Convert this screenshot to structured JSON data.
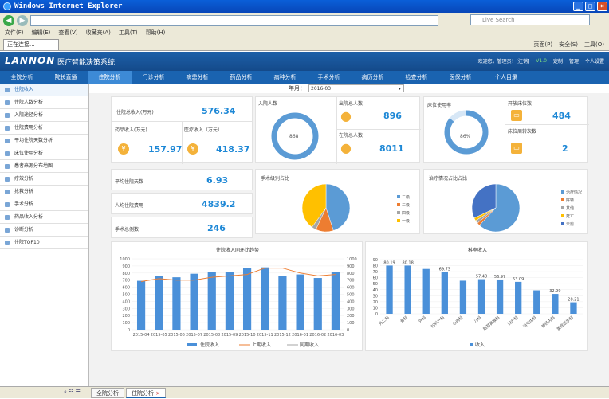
{
  "browser": {
    "title": "Windows Internet Explorer",
    "search_placeholder": "Live Search",
    "menu": [
      "文件(F)",
      "编辑(E)",
      "查看(V)",
      "收藏夹(A)",
      "工具(T)",
      "帮助(H)"
    ],
    "tab_label": "正在连接...",
    "tools": [
      "页面(P)",
      "安全(S)",
      "工具(O)"
    ]
  },
  "app": {
    "logo": "LANNON",
    "title": "医疗智能决策系统",
    "user_text": "欢迎您，管理员！[注销]",
    "version": "V1.0",
    "links": [
      "定制",
      "管理",
      "个人设置"
    ]
  },
  "nav": [
    "全院分析",
    "院长直通",
    "住院分析",
    "门诊分析",
    "病患分析",
    "药品分析",
    "病种分析",
    "手术分析",
    "病历分析",
    "检查分析",
    "医保分析",
    "个人目录"
  ],
  "month": {
    "label": "年月：",
    "value": "2016-03"
  },
  "sidebar": [
    "住院收入",
    "住院人数分析",
    "入院途径分析",
    "住院费用分析",
    "平均住院天数分析",
    "床位使用分析",
    "患者来源分布地图",
    "疗效分析",
    "抢救分析",
    "手术分析",
    "药品收入分析",
    "诊断分析",
    "住院TOP10"
  ],
  "kpi": {
    "inpatient_income_label": "住院总收入(万元)",
    "inpatient_income": "576.34",
    "drug_income_label": "药品收入(万元)",
    "drug_income": "157.97",
    "medical_income_label": "医疗收入（万元）",
    "medical_income": "418.37",
    "admission_label": "入院人数",
    "admission": "868",
    "discharge_label": "出院总人数",
    "discharge": "896",
    "in_hospital_label": "在院总人数",
    "in_hospital": "8011",
    "bed_rate_label": "床位使用率",
    "bed_rate": "86%",
    "open_beds_label": "开放床位数",
    "open_beds": "484",
    "bed_turnover_label": "床位周转次数",
    "bed_turnover": "2",
    "avg_days_label": "平均住院天数",
    "avg_days": "6.93",
    "avg_cost_label": "人均住院费用",
    "avg_cost": "4839.2",
    "surgery_label": "手术总例数",
    "surgery": "246"
  },
  "pie_surgery": {
    "title": "手术级别占比",
    "legend": [
      "二级",
      "三级",
      "四级",
      "一级"
    ],
    "colors": [
      "#5b9bd5",
      "#ed7d31",
      "#a5a5a5",
      "#ffc000"
    ],
    "values": [
      45,
      12,
      3,
      40
    ]
  },
  "pie_outcome": {
    "title": "治疗情况占比占比",
    "legend": [
      "治疗情况",
      "好转",
      "其他",
      "死亡",
      "未愈"
    ],
    "colors": [
      "#5b9bd5",
      "#ed7d31",
      "#a5a5a5",
      "#ffc000",
      "#4472c4"
    ],
    "values": [
      62,
      2,
      2,
      2,
      32
    ]
  },
  "chart_data": [
    {
      "type": "bar",
      "title": "住院收入同环比趋势",
      "categories": [
        "2015-04",
        "2015-05",
        "2015-06",
        "2015-07",
        "2015-08",
        "2015-09",
        "2015-10",
        "2015-11",
        "2015-12",
        "2016-01",
        "2016-02",
        "2016-03"
      ],
      "series": [
        {
          "name": "住院收入",
          "values": [
            690,
            760,
            740,
            790,
            810,
            820,
            870,
            880,
            760,
            780,
            730,
            820
          ]
        },
        {
          "name": "上期收入",
          "values": [
            680,
            720,
            700,
            700,
            740,
            760,
            780,
            870,
            870,
            800,
            760,
            780
          ]
        },
        {
          "name": "同期收入",
          "values": [
            null,
            null,
            null,
            null,
            null,
            null,
            null,
            null,
            null,
            null,
            null,
            null
          ]
        }
      ],
      "ylim": [
        0,
        1000
      ],
      "yticks": [
        0,
        100,
        200,
        300,
        400,
        500,
        600,
        700,
        800,
        900,
        1000
      ]
    },
    {
      "type": "bar",
      "title": "科室收入",
      "categories": [
        "外二科",
        "骨科",
        "外科",
        "妇科产科",
        "心内科",
        "儿科",
        "眼耳鼻喉科",
        "妇产科",
        "消化内科",
        "神经内科",
        "重症医学科"
      ],
      "series": [
        {
          "name": "收入",
          "values": [
            80.19,
            80.18,
            74.5,
            69.73,
            55,
            57.48,
            56.97,
            53.09,
            39,
            32.99,
            19.08
          ]
        }
      ],
      "data_labels": [
        "80.19",
        "80.18",
        "",
        "69.73",
        "",
        "57.48",
        "56.97",
        "53.09",
        "",
        "32.99",
        "28.21",
        "19.08"
      ],
      "ylim": [
        0,
        90
      ],
      "yticks": [
        0,
        10,
        20,
        30,
        40,
        50,
        60,
        70,
        80,
        90
      ]
    }
  ],
  "bottom_tabs": [
    "全院分析",
    "住院分析"
  ]
}
